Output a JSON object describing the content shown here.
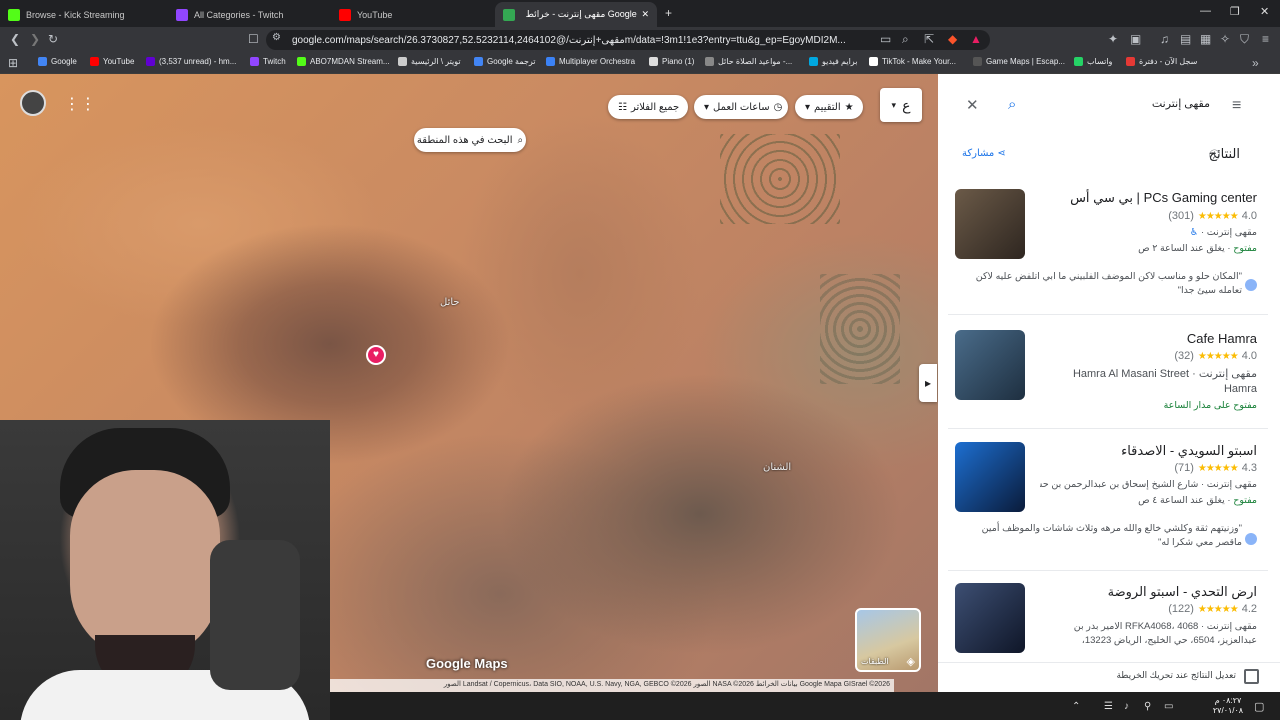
{
  "browser": {
    "tabs": [
      {
        "title": "Browse - Kick Streaming",
        "color": "#53fc18"
      },
      {
        "title": "All Categories - Twitch",
        "color": "#9146ff"
      },
      {
        "title": "YouTube",
        "color": "#ff0000"
      },
      {
        "title": "مقهى إنترنت - خرائط Google",
        "color": "#34a853",
        "active": true
      }
    ],
    "new_tab": "+",
    "url": "google.com/maps/search/مقهى+إنترنت/@26.3730827,52.5232114,2464102m/data=!3m1!1e3?entry=ttu&g_ep=EgoyMDI2M...",
    "bookmarks": [
      {
        "label": "Google",
        "color": "#4285f4"
      },
      {
        "label": "YouTube",
        "color": "#ff0000"
      },
      {
        "label": "(3,537 unread) - hm...",
        "color": "#6001d2"
      },
      {
        "label": "Twitch",
        "color": "#9146ff"
      },
      {
        "label": "ABO7MDAN Stream...",
        "color": "#53fc18"
      },
      {
        "label": "تويتر \\ الرئيسية",
        "color": "#cccccc"
      },
      {
        "label": "Google ترجمة",
        "color": "#4285f4"
      },
      {
        "label": "Multiplayer Orchestra",
        "color": "#3b82f6"
      },
      {
        "label": "Piano (1)",
        "color": "#dddddd"
      },
      {
        "label": "مواعيد الصلاة حائل -...",
        "color": "#888888"
      },
      {
        "label": "برايم فيديو",
        "color": "#00a8e1"
      },
      {
        "label": "TikTok - Make Your...",
        "color": "#ffffff"
      },
      {
        "label": "Game Maps | Escap...",
        "color": "#555555"
      },
      {
        "label": "واتساب",
        "color": "#25d366"
      },
      {
        "label": "سجل الآن - دفترة",
        "color": "#e53935"
      }
    ]
  },
  "map": {
    "filters": {
      "all": "جميع الفلاتر",
      "hours": "ساعات العمل",
      "rating": "التقييم",
      "extra": "ع"
    },
    "search_area": "البحث في هذه المنطقة",
    "labels": {
      "hail": "حائل",
      "other": "الشنان"
    },
    "watermark": "Google Maps",
    "layers_label": "الطبقات",
    "attribution": "Google  Mapa GISrael ©2026 بيانات الخرائط  NASA ©2026 الصور Landsat / Copernicus، Data SIO, NOAA, U.S. Navy, NGA, GEBCO ©2026 الصور"
  },
  "panel": {
    "query": "مقهى إنترنت",
    "results_heading": "النتائج",
    "share": "مشاركة",
    "results": [
      {
        "name": "PCs Gaming center | بي سي أس",
        "rating": "4.0",
        "reviews": "(301)",
        "stars": "★★★★★",
        "category": "مقهى إنترنت",
        "status": "مفتوح",
        "hours": "يغلق عند الساعة ٢ ص",
        "review": "\"المكان حلو و مناسب لاكن الموضف الفلبيني ما ابي اتلفض عليه لاكن تعامله سيئ جدا\"",
        "thumb_color": "#5a4a3a"
      },
      {
        "name": "Cafe Hamra",
        "rating": "4.0",
        "reviews": "(32)",
        "stars": "★★★★★",
        "category": "مقهى إنترنت",
        "address": "Hamra Al Masani Street",
        "address2": "Hamra",
        "status": "مفتوح على مدار الساعة",
        "thumb_color": "#3b5f7a"
      },
      {
        "name": "اسبتو السويدي - الاصدقاء",
        "rating": "4.3",
        "reviews": "(71)",
        "stars": "★★★★★",
        "category": "مقهى إنترنت",
        "address": "شارع الشيخ إسحاق بن عبدالرحمن بن حسن",
        "status": "مفتوح",
        "hours": "يغلق عند الساعة ٤ ص",
        "review": "\"وزنيتهم ثقة وكلشي خالع والله مرهه وثلاث شاشات والموظف أمين ماقصر معي شكرا له\"",
        "thumb_color": "#1f4d8a"
      },
      {
        "name": "ارض التحدي - اسبتو الروضة",
        "rating": "4.2",
        "reviews": "(122)",
        "stars": "★★★★★",
        "category": "مقهى إنترنت",
        "address": "RFKA4068، 4068 الامير بدر بن عبدالعزيز، 6504، حي الخليج، الرياض 13223،",
        "thumb_color": "#2d3b5a"
      }
    ],
    "update_checkbox": "تعديل النتائج عند تحريك الخريطة"
  },
  "taskbar": {
    "time": "٠٨:٢٧ م",
    "date": "٢٧/٠١/٠٨"
  }
}
